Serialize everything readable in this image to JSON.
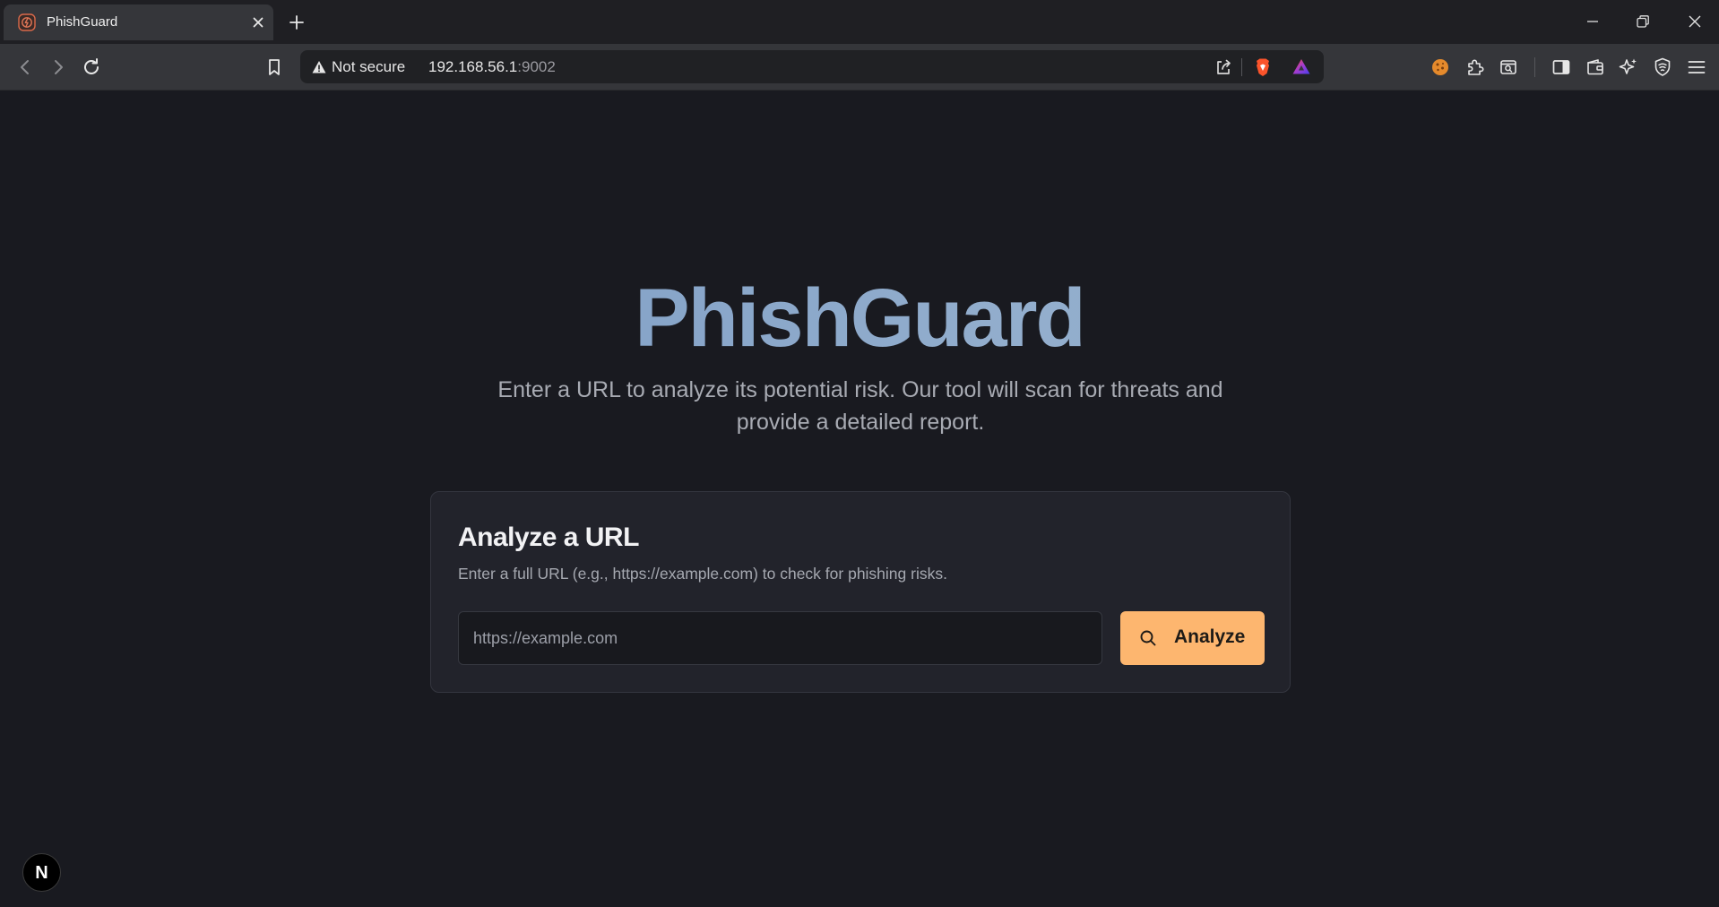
{
  "browser": {
    "tab_title": "PhishGuard",
    "security_label": "Not secure",
    "url_host": "192.168.56.1",
    "url_port": ":9002",
    "icons": [
      "back-icon",
      "forward-icon",
      "reload-icon",
      "bookmark-icon",
      "warning-icon",
      "share-icon",
      "brave-shield-icon",
      "brave-rewards-icon",
      "cookie-extension-icon",
      "extensions-icon",
      "tab-search-icon",
      "sidebar-icon",
      "wallet-icon",
      "leo-ai-icon",
      "vpn-icon",
      "menu-icon"
    ]
  },
  "page": {
    "title": "PhishGuard",
    "subtitle": "Enter a URL to analyze its potential risk. Our tool will scan for threats and provide a detailed report.",
    "card": {
      "title": "Analyze a URL",
      "description": "Enter a full URL (e.g., https://example.com) to check for phishing risks.",
      "input_placeholder": "https://example.com",
      "input_value": "",
      "button_label": "Analyze"
    },
    "dev_badge": "N"
  },
  "colors": {
    "background": "#191a20",
    "card": "#22232b",
    "accent_button": "#fdb66f",
    "title_gradient_start": "#7396c2",
    "title_gradient_end": "#93aecd"
  }
}
